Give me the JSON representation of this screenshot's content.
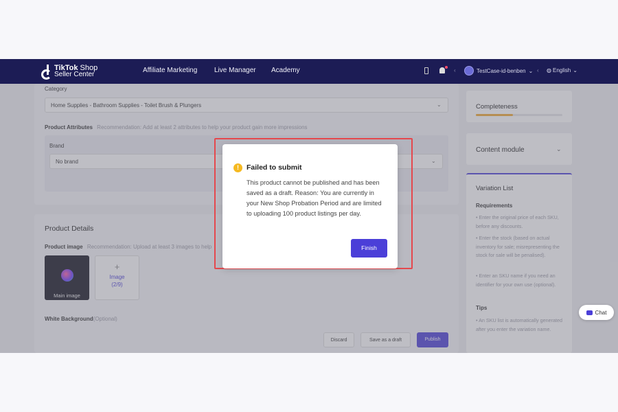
{
  "nav": {
    "brand_line1": "TikTok",
    "brand_line1b": "Shop",
    "brand_line2": "Seller Center",
    "items": [
      "Affiliate Marketing",
      "Live Manager",
      "Academy"
    ],
    "account": "TestCase-id-benben",
    "language": "English"
  },
  "form": {
    "category_label": "Category",
    "category_value": "Home Supplies - Bathroom Supplies - Toilet Brush & Plungers",
    "attributes_label": "Product Attributes",
    "attributes_hint": "Recommendation: Add at least 2 attributes to help your product gain more impressions",
    "brand_label": "Brand",
    "brand_value": "No brand",
    "details_title": "Product Details",
    "image_label": "Product image",
    "image_hint": "Recommendation: Upload at least 3 images to help",
    "main_image_caption": "Main image",
    "add_image_label": "Image",
    "add_image_count": "(2/9)",
    "white_bg_label": "White Background",
    "white_bg_optional": "(Optional)",
    "discard": "Discard",
    "save_draft": "Save as a draft",
    "publish": "Publish"
  },
  "sidebar": {
    "completeness": "Completeness",
    "completeness_fraction": 0.43,
    "content_module": "Content module",
    "variation_list": "Variation List",
    "requirements": "Requirements",
    "req1": "• Enter the original price of each SKU, before any discounts.",
    "req2": "• Enter the stock (based on actual inventory for sale; misrepresenting the stock for sale will be penalised).",
    "req3": "• Enter an SKU name if you need an identifier for your own use (optional).",
    "tips": "Tips",
    "tip1": "• An SKU list is automatically generated after you enter the variation name."
  },
  "modal": {
    "title": "Failed to submit",
    "body": "This product cannot be published and has been saved as a draft. Reason: You are currently in your New Shop Probation Period and are limited to uploading 100 product listings per day.",
    "finish": "Finish"
  },
  "chat": "Chat",
  "colors": {
    "nav": "#1c1c55",
    "primary": "#4b3fd8",
    "warning": "#f5b921",
    "highlight": "#e5484d",
    "progress": "#f0a830"
  }
}
